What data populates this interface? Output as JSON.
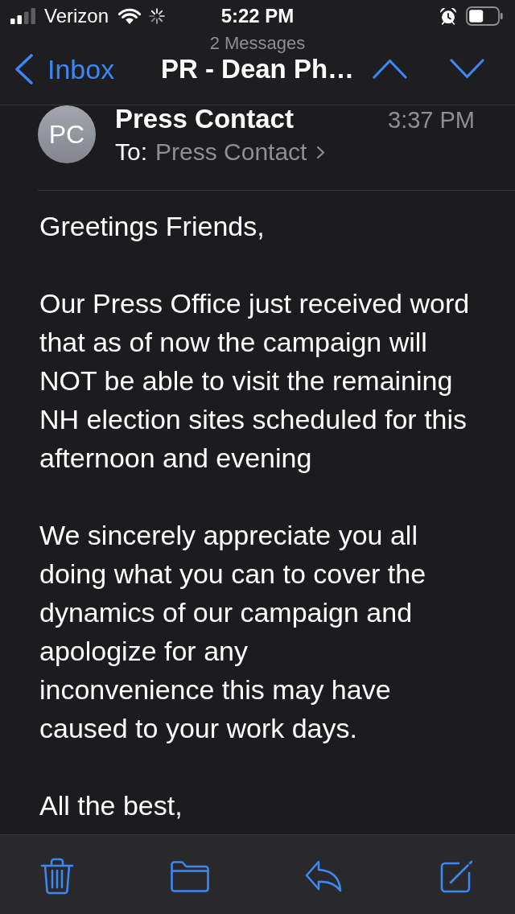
{
  "status_bar": {
    "carrier": "Verizon",
    "time": "5:22 PM"
  },
  "nav_bar": {
    "message_count": "2 Messages",
    "back_label": "Inbox",
    "title": "PR - Dean Ph…"
  },
  "message": {
    "avatar_initials": "PC",
    "sender": "Press Contact",
    "time": "3:37 PM",
    "to_label": "To:",
    "recipient": "Press Contact"
  },
  "body": {
    "paragraphs": [
      "Greetings Friends,",
      "Our Press Office just received word\nthat as of now the campaign will\nNOT be able to visit the remaining\nNH election sites scheduled for this\nafternoon and evening",
      "We sincerely appreciate you all\ndoing what you can to cover the\ndynamics of our campaign and\napologize for any\ninconvenience this may have\ncaused to your work days.",
      "All the best,"
    ]
  }
}
